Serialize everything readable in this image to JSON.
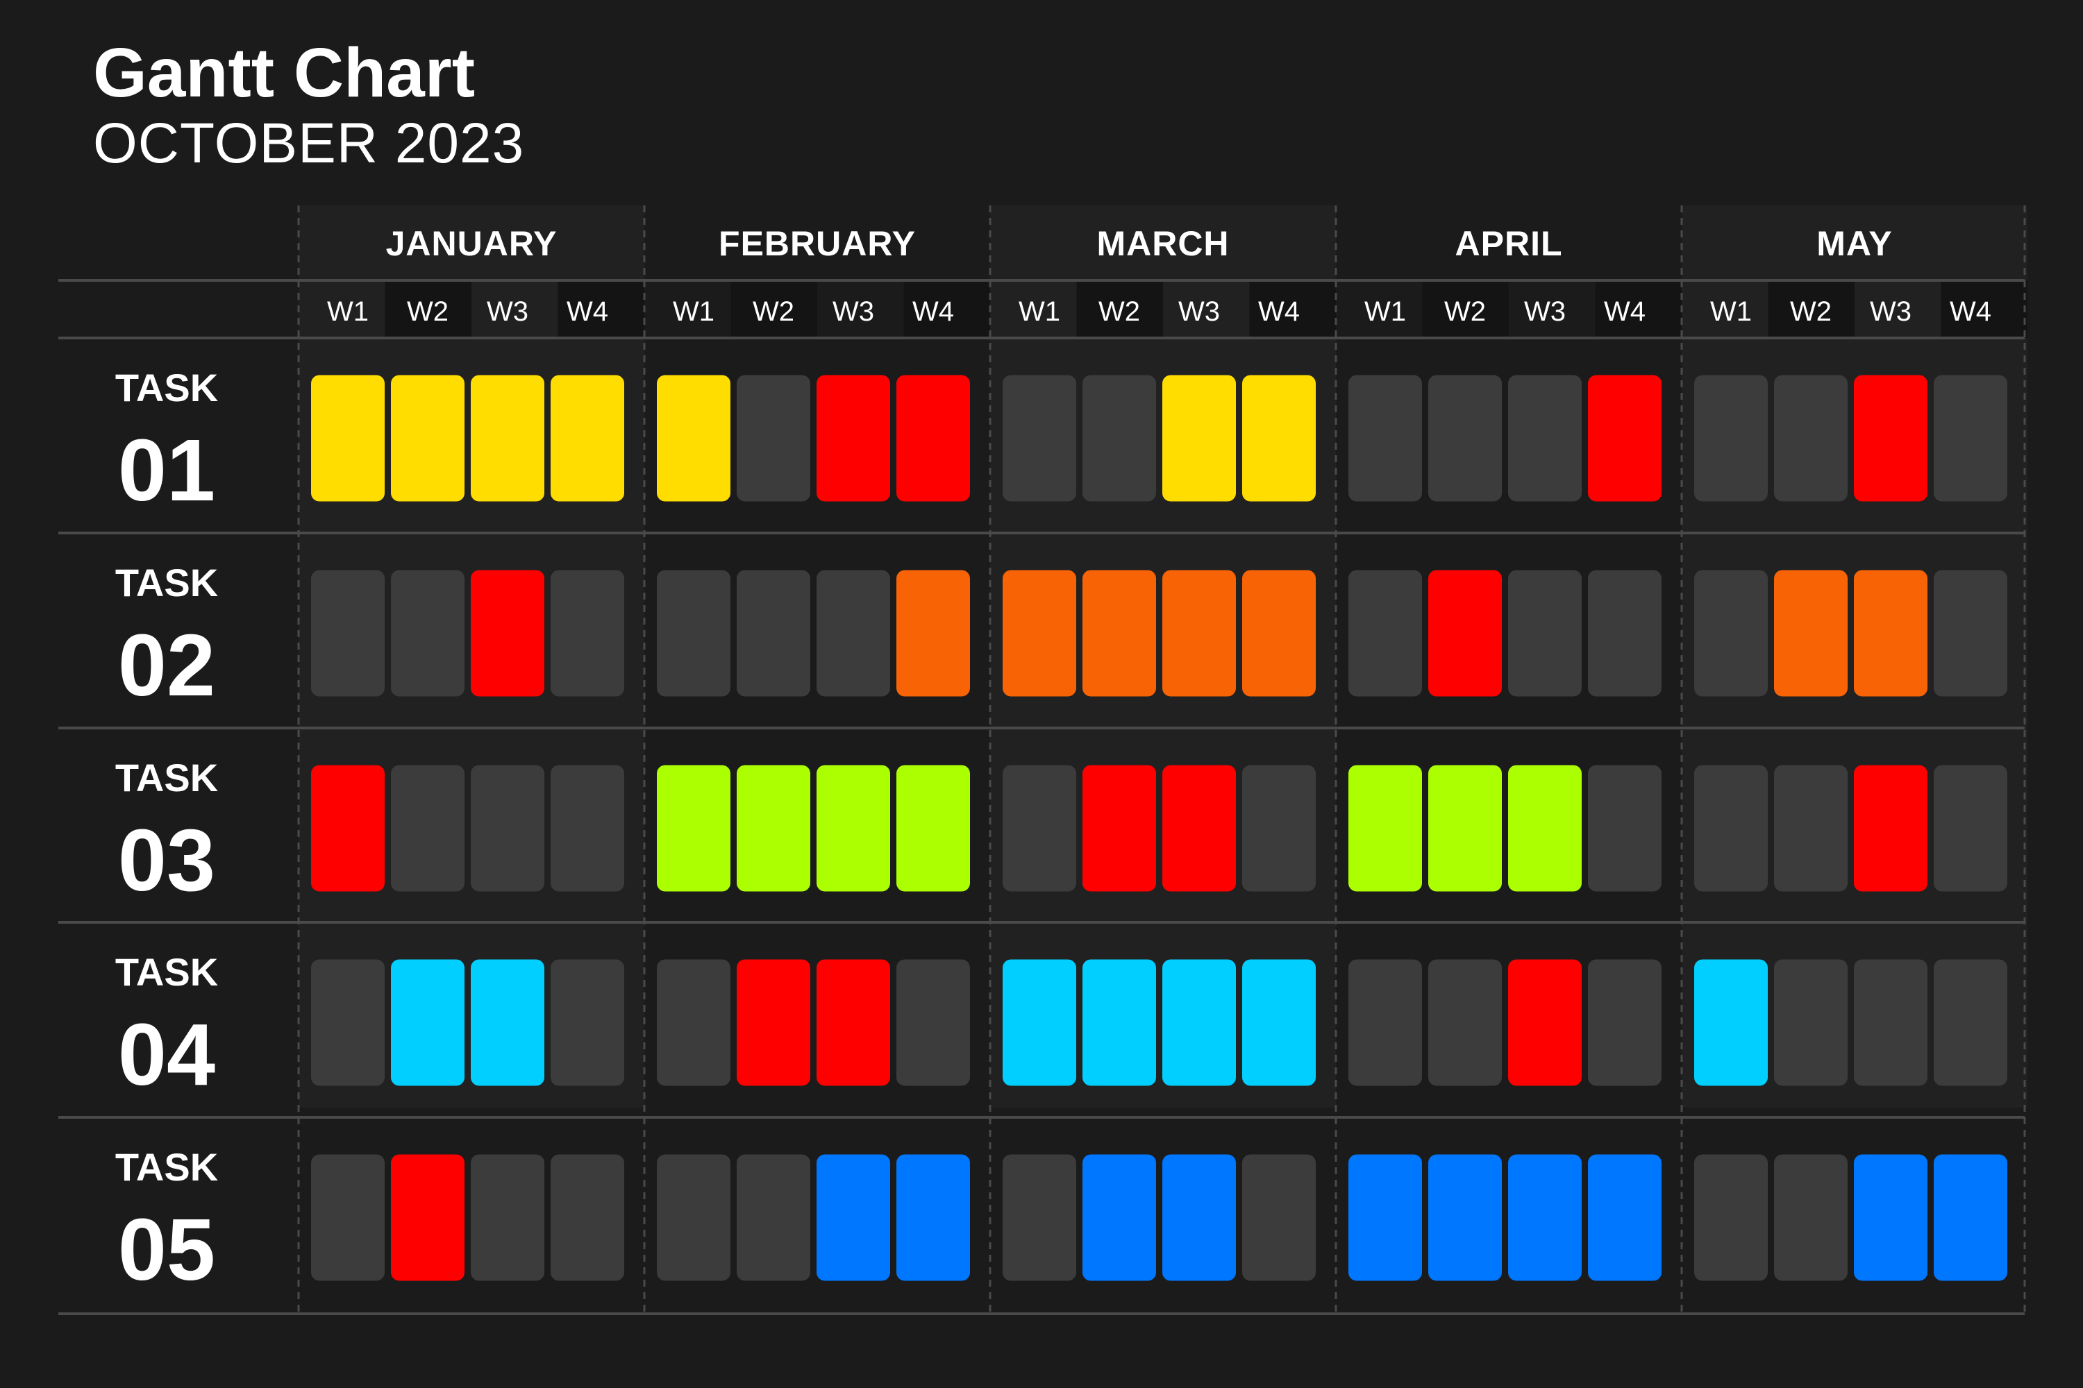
{
  "header": {
    "title": "Gantt Chart",
    "subtitle": "OCTOBER 2023"
  },
  "colors": {
    "background": "#1b1b1b",
    "empty": "#3c3c3c",
    "yellow": "#ffdd00",
    "red": "#ff0000",
    "orange": "#f86306",
    "lime": "#acff00",
    "cyan": "#00cfff",
    "blue": "#0077ff"
  },
  "chart_data": {
    "type": "table",
    "months": [
      "JANUARY",
      "FEBRUARY",
      "MARCH",
      "APRIL",
      "MAY"
    ],
    "weeks": [
      "W1",
      "W2",
      "W3",
      "W4"
    ],
    "tasks": [
      {
        "word": "TASK",
        "number": "01",
        "cells": [
          "yellow",
          "yellow",
          "yellow",
          "yellow",
          "yellow",
          "empty",
          "red",
          "red",
          "empty",
          "empty",
          "yellow",
          "yellow",
          "empty",
          "empty",
          "empty",
          "red",
          "empty",
          "empty",
          "red",
          "empty"
        ]
      },
      {
        "word": "TASK",
        "number": "02",
        "cells": [
          "empty",
          "empty",
          "red",
          "empty",
          "empty",
          "empty",
          "empty",
          "orange",
          "orange",
          "orange",
          "orange",
          "orange",
          "empty",
          "red",
          "empty",
          "empty",
          "empty",
          "orange",
          "orange",
          "empty"
        ]
      },
      {
        "word": "TASK",
        "number": "03",
        "cells": [
          "red",
          "empty",
          "empty",
          "empty",
          "lime",
          "lime",
          "lime",
          "lime",
          "empty",
          "red",
          "red",
          "empty",
          "lime",
          "lime",
          "lime",
          "empty",
          "empty",
          "empty",
          "red",
          "empty"
        ]
      },
      {
        "word": "TASK",
        "number": "04",
        "cells": [
          "empty",
          "cyan",
          "cyan",
          "empty",
          "empty",
          "red",
          "red",
          "empty",
          "cyan",
          "cyan",
          "cyan",
          "cyan",
          "empty",
          "empty",
          "red",
          "empty",
          "cyan",
          "empty",
          "empty",
          "empty"
        ]
      },
      {
        "word": "TASK",
        "number": "05",
        "cells": [
          "empty",
          "red",
          "empty",
          "empty",
          "empty",
          "empty",
          "blue",
          "blue",
          "empty",
          "blue",
          "blue",
          "empty",
          "blue",
          "blue",
          "blue",
          "blue",
          "empty",
          "empty",
          "blue",
          "blue"
        ]
      }
    ]
  }
}
